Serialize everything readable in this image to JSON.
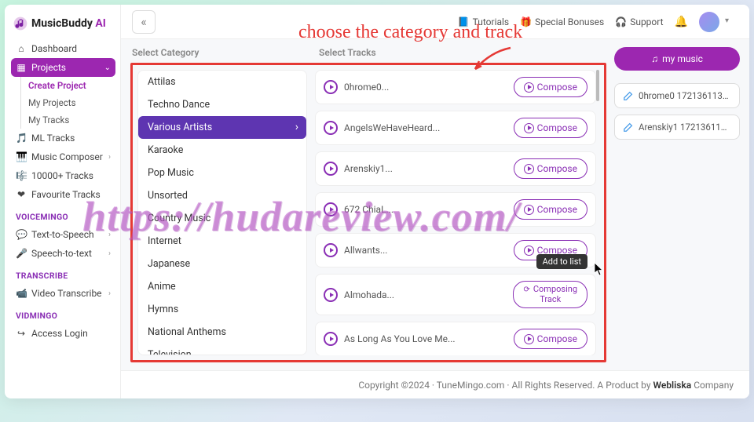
{
  "logo": {
    "brand": "MusicBuddy",
    "suffix": "AI"
  },
  "sidebar": {
    "dashboard": "Dashboard",
    "projects": "Projects",
    "projects_sub": [
      "Create Project",
      "My Projects",
      "My Tracks"
    ],
    "items": [
      {
        "icon": "🎵",
        "label": "ML Tracks"
      },
      {
        "icon": "🎹",
        "label": "Music Composer"
      },
      {
        "icon": "🎼",
        "label": "10000+ Tracks"
      },
      {
        "icon": "❤",
        "label": "Favourite Tracks"
      }
    ],
    "section_voice": "VOICEMINGO",
    "voice_items": [
      {
        "icon": "💬",
        "label": "Text-to-Speech"
      },
      {
        "icon": "🎤",
        "label": "Speech-to-text"
      }
    ],
    "section_transcribe": "TRANSCRIBE",
    "transcribe_items": [
      {
        "icon": "📹",
        "label": "Video Transcribe"
      }
    ],
    "section_vid": "VIDMINGO",
    "vid_items": [
      {
        "icon": "↪",
        "label": "Access Login"
      }
    ]
  },
  "topbar": {
    "tutorials": "Tutorials",
    "bonuses": "Special Bonuses",
    "support": "Support"
  },
  "headings": {
    "category": "Select Category",
    "tracks": "Select Tracks"
  },
  "categories": [
    "Attilas",
    "Techno Dance",
    "Various Artists",
    "Karaoke",
    "Pop Music",
    "Unsorted",
    "Country Music",
    "Internet",
    "Japanese",
    "Anime",
    "Hymns",
    "National Anthems",
    "Television"
  ],
  "selected_category_index": 2,
  "tracks": [
    {
      "name": "0hrome0...",
      "state": "idle"
    },
    {
      "name": "AngelsWeHaveHeard...",
      "state": "idle"
    },
    {
      "name": "Arenskiy1...",
      "state": "idle"
    },
    {
      "name": "672 ChiaL...",
      "state": "idle"
    },
    {
      "name": "Allwants...",
      "state": "idle"
    },
    {
      "name": "Almohada...",
      "state": "busy"
    },
    {
      "name": "As Long As You Love Me...",
      "state": "idle"
    }
  ],
  "compose_label": "Compose",
  "composing_label": "Composing Track",
  "tooltip_add": "Add to list",
  "right": {
    "my_music": "my music",
    "items": [
      "0hrome0 1721361133...",
      "Arenskiy1 1721361136..."
    ]
  },
  "footer": {
    "left": "Copyright ©2024 · TuneMingo.com · All Rights Reserved. A Product by ",
    "brand": "Webliska",
    "right": " Company"
  },
  "annotation": "choose the category and track",
  "watermark": "https://hudareview.com/"
}
